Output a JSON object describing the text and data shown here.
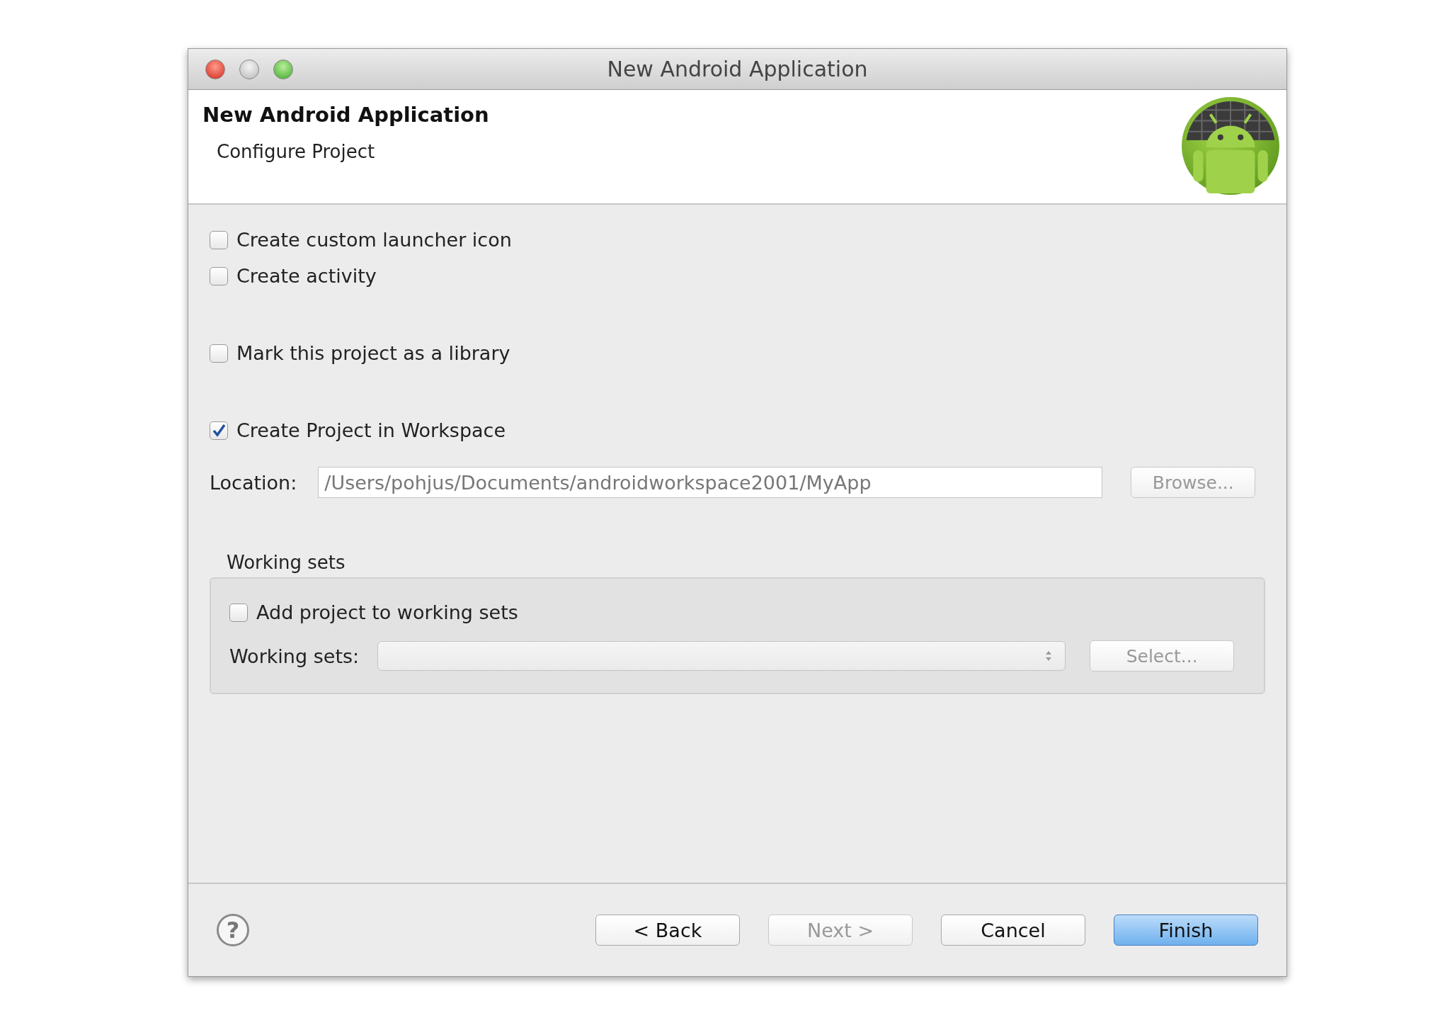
{
  "window": {
    "title": "New Android Application"
  },
  "header": {
    "title": "New Android Application",
    "subtitle": "Configure Project"
  },
  "options": [
    {
      "label": "Create custom launcher icon",
      "checked": false
    },
    {
      "label": "Create activity",
      "checked": false
    },
    {
      "label": "Mark this project as a library",
      "checked": false
    },
    {
      "label": "Create Project in Workspace",
      "checked": true
    }
  ],
  "location": {
    "label": "Location:",
    "value": "/Users/pohjus/Documents/androidworkspace2001/MyApp",
    "disabled": true,
    "button": {
      "label": "Browse...",
      "disabled": true
    }
  },
  "working_sets": {
    "title": "Working sets",
    "add_option": {
      "label": "Add project to working sets",
      "checked": false
    },
    "label": "Working sets:",
    "disabled": true,
    "button": {
      "label": "Select...",
      "disabled": true
    }
  },
  "footer": {
    "help": "?",
    "buttons": [
      {
        "label": "< Back",
        "disabled": false,
        "default": false
      },
      {
        "label": "Next >",
        "disabled": true,
        "default": false
      },
      {
        "label": "Cancel",
        "disabled": false,
        "default": false
      },
      {
        "label": "Finish",
        "disabled": false,
        "default": true
      }
    ]
  }
}
